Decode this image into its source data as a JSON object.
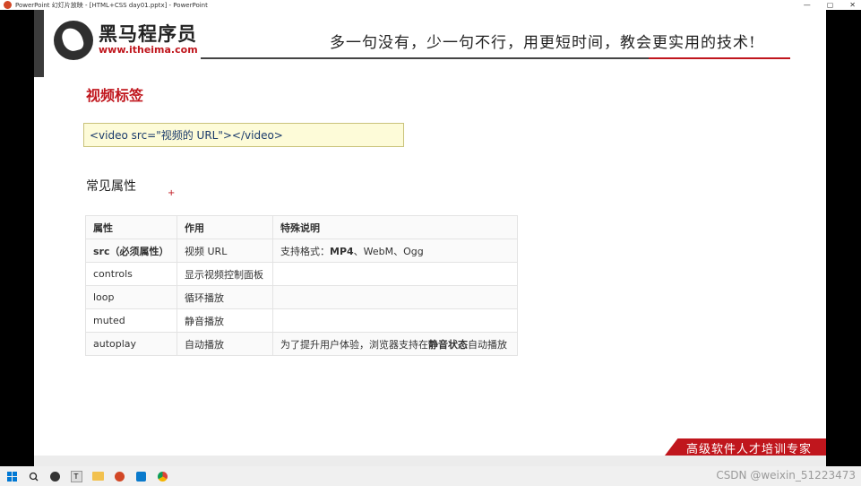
{
  "window": {
    "title": "PowerPoint 幻灯片放映 - [HTML+CSS day01.pptx] - PowerPoint",
    "controls": [
      "—",
      "▢",
      "✕"
    ]
  },
  "brand": {
    "name_cn": "黑马程序员",
    "url": "www.itheima.com",
    "slogan": "多一句没有，少一句不行，用更短时间，教会更实用的技术!"
  },
  "slide": {
    "section_title": "视频标签",
    "code": "<video src=\"视频的 URL\"></video>",
    "subtitle": "常见属性",
    "plus": "+",
    "table": {
      "headers": [
        "属性",
        "作用",
        "特殊说明"
      ],
      "rows": [
        {
          "attr": "src（必须属性）",
          "role": "视频 URL",
          "note_pre": "支持格式：",
          "note_bold": "MP4",
          "note_post": "、WebM、Ogg"
        },
        {
          "attr": "controls",
          "role": "显示视频控制面板",
          "note_pre": "",
          "note_bold": "",
          "note_post": ""
        },
        {
          "attr": "loop",
          "role": "循环播放",
          "note_pre": "",
          "note_bold": "",
          "note_post": ""
        },
        {
          "attr": "muted",
          "role": "静音播放",
          "note_pre": "",
          "note_bold": "",
          "note_post": ""
        },
        {
          "attr": "autoplay",
          "role": "自动播放",
          "note_pre": "为了提升用户体验，浏览器支持在",
          "note_bold": "静音状态",
          "note_post": "自动播放"
        }
      ]
    },
    "banner": "高级软件人才培训专家"
  },
  "taskbar": {
    "icons": [
      "windows-icon",
      "search-icon",
      "obs-icon",
      "typora-icon",
      "folder-icon",
      "powerpoint-icon",
      "vscode-icon",
      "chrome-icon"
    ]
  },
  "watermark": "CSDN @weixin_51223473",
  "colors": {
    "accent": "#c0161d",
    "code_bg": "#fdfbd8"
  }
}
